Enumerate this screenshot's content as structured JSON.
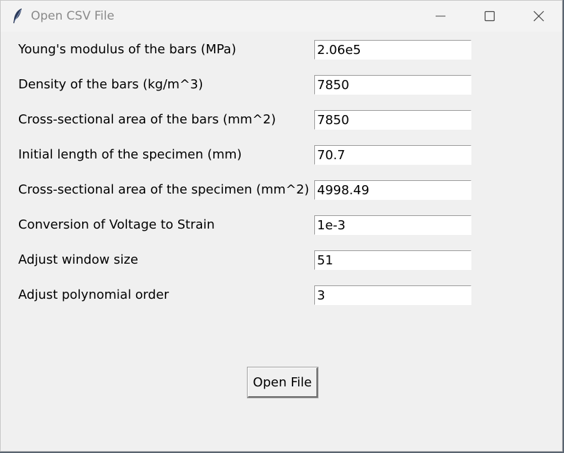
{
  "window": {
    "title": "Open CSV File",
    "app_icon": "feather-icon",
    "controls": {
      "minimize_icon": "minimize-icon",
      "maximize_icon": "maximize-icon",
      "close_icon": "close-icon"
    }
  },
  "fields": [
    {
      "label": "Young's modulus of the bars (MPa)",
      "value": "2.06e5"
    },
    {
      "label": "Density of the bars (kg/m^3)",
      "value": "7850"
    },
    {
      "label": "Cross-sectional area of the bars (mm^2)",
      "value": "7850"
    },
    {
      "label": "Initial length of the specimen (mm)",
      "value": "70.7"
    },
    {
      "label": "Cross-sectional area of the specimen (mm^2)",
      "value": "4998.49"
    },
    {
      "label": "Conversion of Voltage to Strain",
      "value": "1e-3"
    },
    {
      "label": "Adjust window size",
      "value": "51"
    },
    {
      "label": "Adjust polynomial order",
      "value": "3"
    }
  ],
  "actions": {
    "open_file_label": "Open File"
  }
}
